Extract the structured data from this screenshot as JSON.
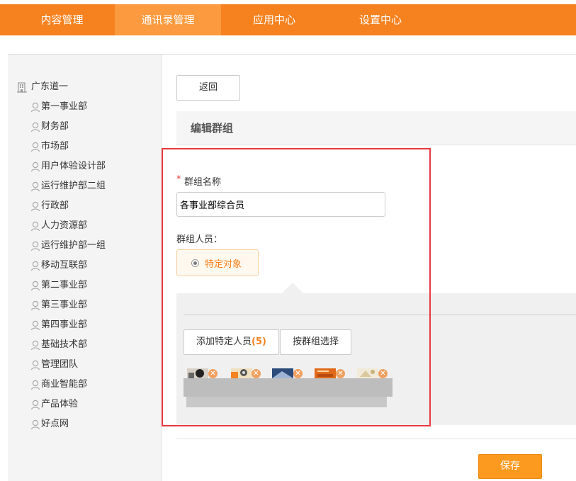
{
  "nav": {
    "items": [
      {
        "label": "内容管理"
      },
      {
        "label": "通讯录管理"
      },
      {
        "label": "应用中心"
      },
      {
        "label": "设置中心"
      }
    ],
    "active_index": 1
  },
  "sidebar": {
    "root": {
      "label": "广东道一",
      "icon": "building-icon"
    },
    "items": [
      {
        "label": "第一事业部"
      },
      {
        "label": "财务部"
      },
      {
        "label": "市场部"
      },
      {
        "label": "用户体验设计部"
      },
      {
        "label": "运行维护部二组"
      },
      {
        "label": "行政部"
      },
      {
        "label": "人力资源部"
      },
      {
        "label": "运行维护部一组"
      },
      {
        "label": "移动互联部"
      },
      {
        "label": "第二事业部"
      },
      {
        "label": "第三事业部"
      },
      {
        "label": "第四事业部"
      },
      {
        "label": "基础技术部"
      },
      {
        "label": "管理团队"
      },
      {
        "label": "商业智能部"
      },
      {
        "label": "产品体验"
      },
      {
        "label": "好点网"
      }
    ]
  },
  "main": {
    "back_label": "返回",
    "section_title": "编辑群组",
    "required_mark": "*",
    "group_name_label": "群组名称",
    "group_name_value": "各事业部综合员",
    "group_members_label": "群组人员：",
    "radio_option_label": "特定对象",
    "add_specific_label": "添加特定人员",
    "add_specific_count": "(5)",
    "select_by_group_label": "按群组选择",
    "avatars": [
      {
        "icon": "member-avatar-1"
      },
      {
        "icon": "member-avatar-2"
      },
      {
        "icon": "member-avatar-3"
      },
      {
        "icon": "member-avatar-4"
      },
      {
        "icon": "member-avatar-5"
      }
    ],
    "remove_glyph": "✕",
    "save_label": "保存"
  },
  "colors": {
    "brand_orange": "#f5821f",
    "nav_active": "#fb9a3e",
    "highlight_red": "#e8383f"
  }
}
